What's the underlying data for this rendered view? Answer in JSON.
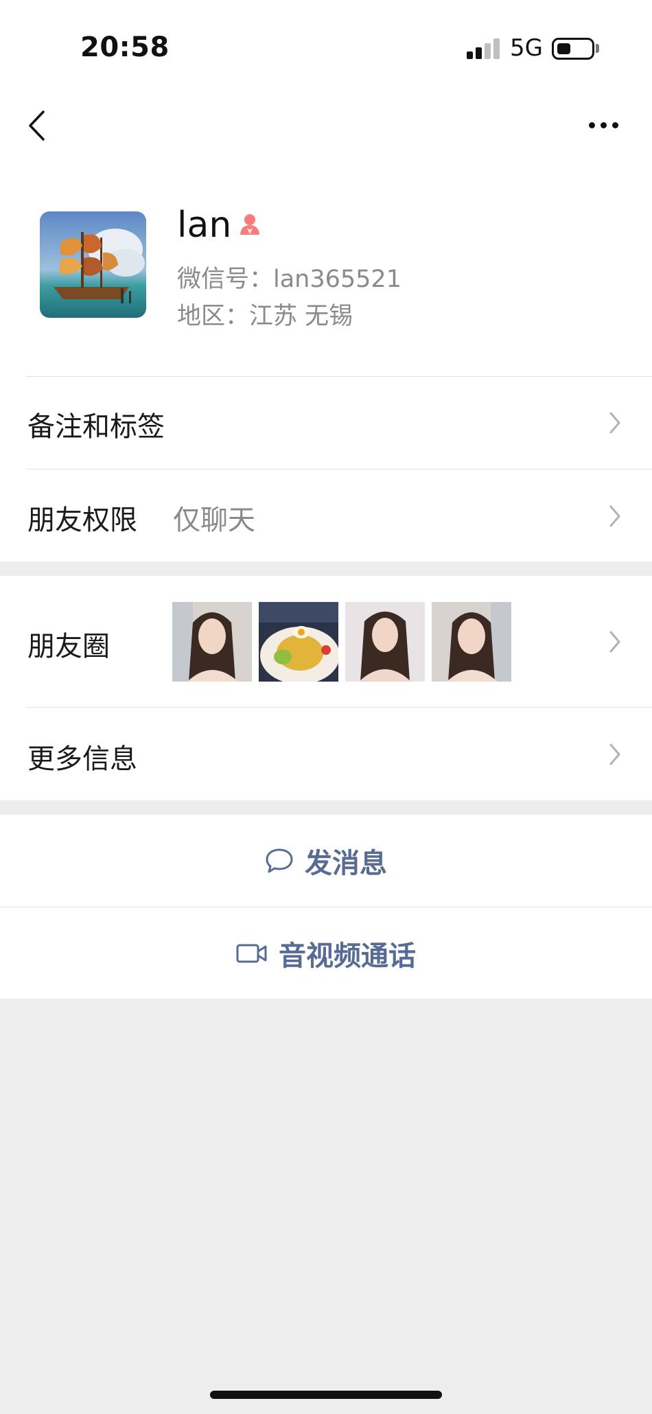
{
  "status_bar": {
    "time": "20:58",
    "network": "5G"
  },
  "profile": {
    "name": "lan",
    "wechat_id": "微信号：lan365521",
    "region": "地区：江苏 无锡"
  },
  "rows": {
    "remarks_tags": "备注和标签",
    "friend_permissions": {
      "label": "朋友权限",
      "value": "仅聊天"
    },
    "moments": "朋友圈",
    "more_info": "更多信息"
  },
  "actions": {
    "send_message": "发消息",
    "av_call": "音视频通话"
  },
  "icons": [
    "back-icon",
    "more-icon",
    "female-gender-icon",
    "chevron-right-icon",
    "chat-bubble-icon",
    "video-camera-icon"
  ],
  "colors": {
    "link_blue": "#576b95",
    "gender_pink": "#fa7b7b",
    "secondary_text": "#8a8a8a",
    "background": "#ededed"
  }
}
